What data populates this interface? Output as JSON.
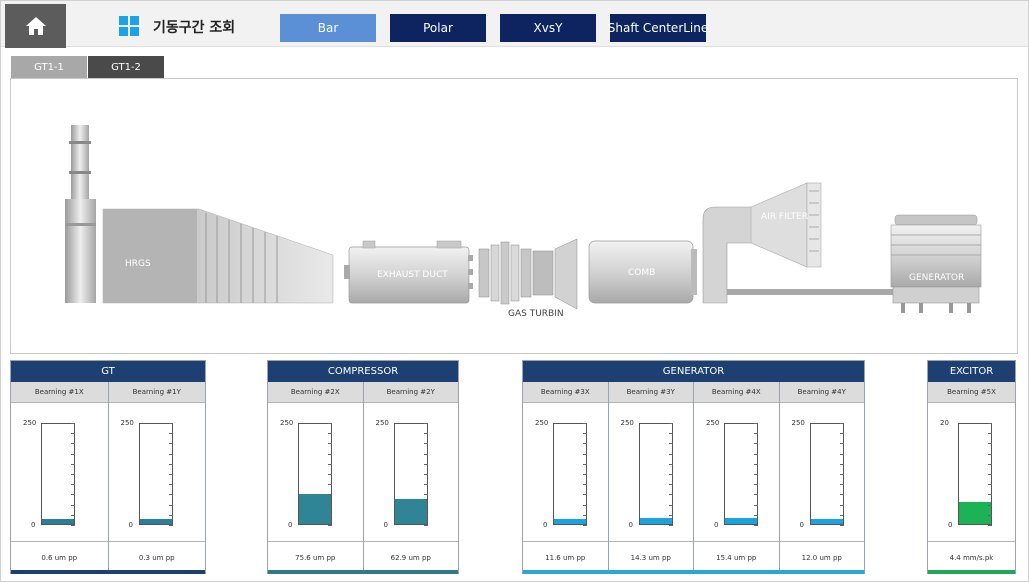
{
  "header": {
    "title": "기동구간 조회",
    "nav": [
      {
        "label": "Bar",
        "active": true
      },
      {
        "label": "Polar",
        "active": false
      },
      {
        "label": "XvsY",
        "active": false
      },
      {
        "label": "Shaft CenterLine",
        "active": false
      }
    ]
  },
  "tabs": [
    {
      "label": "GT1-1",
      "active": true
    },
    {
      "label": "GT1-2",
      "active": false
    }
  ],
  "diagram": {
    "hrgs": "HRGS",
    "exhaust_duct": "EXHAUST DUCT",
    "gas_turbin": "GAS TURBIN",
    "comb": "COMB",
    "air_filter": "AIR FILTER",
    "generator": "GENERATOR"
  },
  "panels": [
    {
      "title": "GT",
      "bar_color": "#1e3f72",
      "fill_color": "#2a7f99",
      "bearings": [
        {
          "label": "Bearning #1X",
          "max": "250",
          "min": "0",
          "value": 0.6,
          "readout": "0.6 um pp"
        },
        {
          "label": "Bearning #1Y",
          "max": "250",
          "min": "0",
          "value": 0.3,
          "readout": "0.3 um pp"
        }
      ]
    },
    {
      "title": "COMPRESSOR",
      "bar_color": "#2f7a86",
      "fill_color": "#2f8496",
      "bearings": [
        {
          "label": "Bearning #2X",
          "max": "250",
          "min": "0",
          "value": 75.6,
          "readout": "75.6 um pp"
        },
        {
          "label": "Bearning #2Y",
          "max": "250",
          "min": "0",
          "value": 62.9,
          "readout": "62.9 um pp"
        }
      ]
    },
    {
      "title": "GENERATOR",
      "bar_color": "#2aa6d9",
      "fill_color": "#1aa3dc",
      "bearings": [
        {
          "label": "Bearning #3X",
          "max": "250",
          "min": "0",
          "value": 11.6,
          "readout": "11.6 um pp"
        },
        {
          "label": "Bearning #3Y",
          "max": "250",
          "min": "0",
          "value": 14.3,
          "readout": "14.3 um pp"
        },
        {
          "label": "Bearning #4X",
          "max": "250",
          "min": "0",
          "value": 15.4,
          "readout": "15.4 um pp"
        },
        {
          "label": "Bearning #4Y",
          "max": "250",
          "min": "0",
          "value": 12.0,
          "readout": "12.0 um pp"
        }
      ]
    },
    {
      "title": "EXCITOR",
      "bar_color": "#1fa85a",
      "fill_color": "#1cb356",
      "bearings": [
        {
          "label": "Bearning #5X",
          "max": "20",
          "min": "0",
          "value": 4.4,
          "readout": "4.4 mm/s.pk"
        }
      ]
    }
  ]
}
